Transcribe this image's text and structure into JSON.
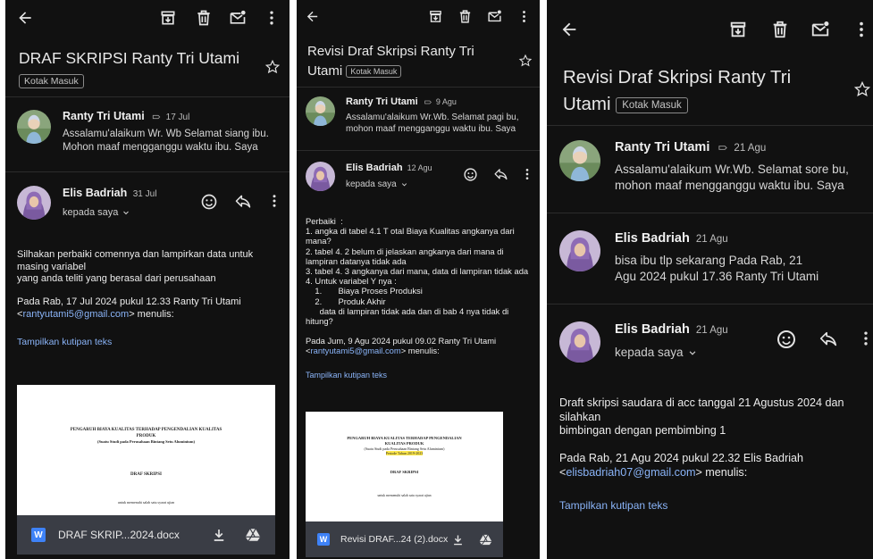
{
  "panel1": {
    "title": "DRAF SKRIPSI Ranty Tri Utami",
    "label": "Kotak Masuk",
    "msg1": {
      "sender": "Ranty Tri Utami",
      "date": "17 Jul",
      "snippet_line1": "Assalamu'alaikum Wr. Wb Selamat siang ibu.",
      "snippet_line2": "Mohon maaf mengganggu waktu ibu. Saya"
    },
    "msg2": {
      "sender": "Elis Badriah",
      "date": "31 Jul",
      "to": "kepada saya",
      "body": "Silhakan perbaiki comennya dan lampirkan data untuk\nmasing variabel\nyang anda teliti yang berasal dari perusahaan",
      "reply_line1": "Pada Rab, 17 Jul 2024 pukul 12.33 Ranty Tri Utami",
      "reply_email": "rantyutami5@gmail.com",
      "reply_suffix": "> menulis:",
      "reply_prefix": "<",
      "show_quote": "Tampilkan kutipan teks",
      "doc_title": "PENGARUH BIAYA KUALITAS TERHADAP PENGENDALIAN KUALITAS PRODUK",
      "doc_subtitle": "(Suatu Studi pada Perusahaan Bintang Setu Aluminium)",
      "doc_section": "DRAF SKRIPSI",
      "doc_note": "untuk memenuhi salah satu syarat ujian",
      "attachment_name": "DRAF SKRIP...2024.docx",
      "word_letter": "W"
    }
  },
  "panel2": {
    "title_line1": "Revisi Draf Skripsi Ranty Tri",
    "title_line2": "Utami",
    "label": "Kotak Masuk",
    "msg1": {
      "sender": "Ranty Tri Utami",
      "date": "9 Agu",
      "snippet_line1": "Assalamu'alaikum Wr.Wb. Selamat pagi bu,",
      "snippet_line2": "mohon maaf mengganggu waktu ibu. Saya"
    },
    "msg2": {
      "sender": "Elis Badriah",
      "date": "12 Agu",
      "to": "kepada saya",
      "body": "Perbaiki  :\n1. angka di tabel 4.1 T otal Biaya Kualitas angkanya dari\nmana?\n2. tabel 4. 2 belum di jelaskan angkanya dari mana di\nlampiran datanya tidak ada\n3. tabel 4. 3 angkanya dari mana, data di lampiran tidak ada\n4. Untuk variabel Y nya :\n    1.       Biaya Proses Produksi\n    2.       Produk Akhir\n      data di lampiran tidak ada dan di bab 4 nya tidak di\nhitung?",
      "reply_line1": "Pada Jum, 9 Agu 2024 pukul 09.02 Ranty Tri Utami",
      "reply_prefix": "<",
      "reply_email": "rantyutami5@gmail.com",
      "reply_suffix": "> menulis:",
      "show_quote": "Tampilkan kutipan teks",
      "doc_title": "PENGARUH BIAYA KUALITAS TERHADAP PENGENDALIAN KUALITAS PRODUK",
      "doc_subtitle": "(Suatu Studi pada Perusahaan Bintang Setu Aluminium)",
      "doc_highlight": "Periode Tahun 2019-2023",
      "doc_section": "DRAF SKRIPSI",
      "doc_note": "untuk memenuhi salah satu syarat ujian",
      "attachment_name": "Revisi DRAF...24 (2).docx",
      "word_letter": "W"
    }
  },
  "panel3": {
    "title_line1": "Revisi Draf Skripsi Ranty Tri",
    "title_line2": "Utami",
    "label": "Kotak Masuk",
    "msg1": {
      "sender": "Ranty Tri Utami",
      "date": "21 Agu",
      "snippet_line1": "Assalamu'alaikum Wr.Wb. Selamat sore bu,",
      "snippet_line2": "mohon maaf mengganggu waktu ibu. Saya"
    },
    "msg2": {
      "sender": "Elis Badriah",
      "date": "21 Agu",
      "snippet_line1": "bisa ibu tlp sekarang Pada Rab, 21",
      "snippet_line2": "Agu 2024 pukul 17.36 Ranty Tri Utami"
    },
    "msg3": {
      "sender": "Elis Badriah",
      "date": "21 Agu",
      "to": "kepada saya",
      "body": "Draft skripsi saudara di acc tanggal 21 Agustus 2024 dan\nsilahkan\nbimbingan dengan pembimbing 1",
      "reply_line1": "Pada Rab, 21 Agu 2024 pukul 22.32 Elis Badriah",
      "reply_prefix": "<",
      "reply_email": "elisbadriah07@gmail.com",
      "reply_suffix": "> menulis:",
      "show_quote": "Tampilkan kutipan teks"
    }
  },
  "colors": {
    "background": "#111111",
    "link": "#8ab4f8",
    "text": "#e3e3e3"
  }
}
